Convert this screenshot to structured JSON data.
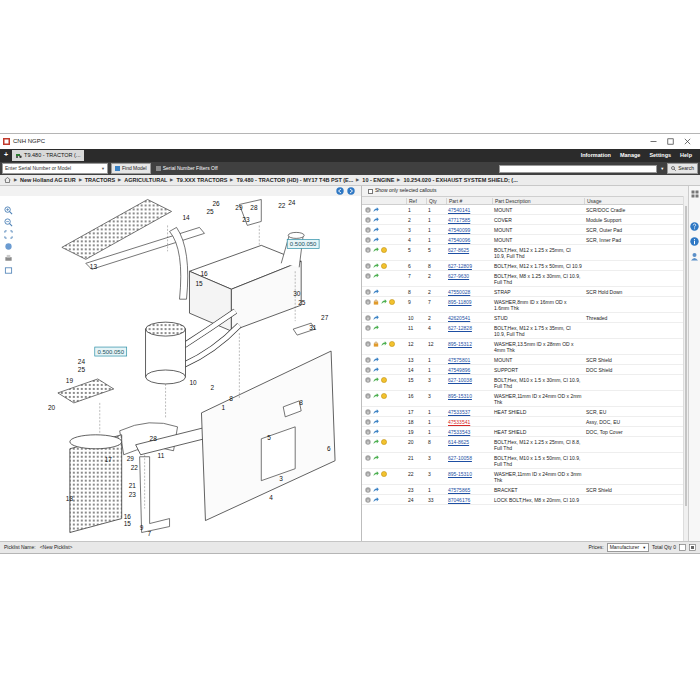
{
  "window": {
    "title": "CNH NGPC"
  },
  "tabs": {
    "new_tab": "+",
    "items": [
      {
        "label": "T9.480 - TRACTOR (...",
        "selected": true
      }
    ]
  },
  "menu": [
    "Information",
    "Manage",
    "Settings",
    "Help"
  ],
  "search_bar": {
    "serial_placeholder": "Enter Serial Number or Model",
    "find_button": "Find Model",
    "filter_label": "Serial Number Filters Off",
    "search_button": "Search"
  },
  "breadcrumb": {
    "separator": "▶",
    "items": [
      "New Holland AG EUR",
      "TRACTORS",
      "AGRICULTURAL",
      "T9.XXX TRACTORS",
      "T9.480 - TRACTOR (HD) - MY17 T4B PST (E...",
      "10 - ENGINE",
      "10.254.020 - EXHAUST SYSTEM SHIELD; (..."
    ]
  },
  "diagram": {
    "callouts": [
      "26",
      "25",
      "13",
      "14",
      "29",
      "28",
      "23",
      "22",
      "24",
      "16",
      "15",
      "30",
      "25",
      "27",
      "31",
      "24",
      "25",
      "19",
      "20",
      "10",
      "2",
      "8",
      "1",
      "28",
      "11",
      "29",
      "17",
      "22",
      "21",
      "23",
      "8",
      "5",
      "3",
      "4",
      "18",
      "16",
      "15",
      "9",
      "7",
      "6"
    ],
    "boxes": [
      "0.500.050",
      "0.500.050"
    ]
  },
  "table": {
    "filter": {
      "label": "Show only selected callouts",
      "checked": false
    },
    "columns": [
      "Ref",
      "Qty",
      "Part #",
      "Part Description",
      "Usage"
    ],
    "rows": [
      {
        "ref": "1",
        "qty": "1",
        "part": "47540141",
        "desc": "MOUNT",
        "usage": "SCR/DOC Cradle",
        "icons": [
          "info",
          "link"
        ],
        "color": "#1e4fa3"
      },
      {
        "ref": "2",
        "qty": "1",
        "part": "47717585",
        "desc": "COVER",
        "usage": "Module Support",
        "icons": [
          "info",
          "link"
        ],
        "color": "#1e4fa3"
      },
      {
        "ref": "3",
        "qty": "1",
        "part": "47540099",
        "desc": "MOUNT",
        "usage": "SCR, Outer Pad",
        "icons": [
          "info",
          "link"
        ],
        "color": "#1e4fa3"
      },
      {
        "ref": "4",
        "qty": "1",
        "part": "47540096",
        "desc": "MOUNT",
        "usage": "SCR, Inner Pad",
        "icons": [
          "info",
          "link"
        ],
        "color": "#1e4fa3"
      },
      {
        "ref": "5",
        "qty": "5",
        "part": "627-8625",
        "desc": "BOLT,Hex, M12 x 1.25 x 25mm, Cl 10.9, Full Thd",
        "usage": "",
        "icons": [
          "info",
          "green",
          "yellow"
        ],
        "color": "#1e4fa3"
      },
      {
        "ref": "6",
        "qty": "8",
        "part": "627-12809",
        "desc": "BOLT,Hex, M12 x 1.75 x 50mm, Cl 10.9",
        "usage": "",
        "icons": [
          "info",
          "green",
          "yellow"
        ],
        "color": "#1e4fa3"
      },
      {
        "ref": "7",
        "qty": "2",
        "part": "627-9630",
        "desc": "BOLT,Hex, M8 x 1.25 x 30mm, Cl 10.9, Full Thd",
        "usage": "",
        "icons": [
          "info",
          "green"
        ],
        "color": "#1e4fa3"
      },
      {
        "ref": "8",
        "qty": "2",
        "part": "47550028",
        "desc": "STRAP",
        "usage": "SCR Hold Down",
        "icons": [
          "info",
          "link"
        ],
        "color": "#1e4fa3"
      },
      {
        "ref": "9",
        "qty": "7",
        "part": "895-11809",
        "desc": "WASHER,8mm ID x 16mm OD x 1.6mm Thk",
        "usage": "",
        "icons": [
          "info",
          "lock",
          "green",
          "yellow"
        ],
        "color": "#1e4fa3"
      },
      {
        "ref": "10",
        "qty": "2",
        "part": "42620541",
        "desc": "STUD",
        "usage": "Threaded",
        "icons": [
          "info",
          "link"
        ],
        "color": "#1e4fa3"
      },
      {
        "ref": "11",
        "qty": "4",
        "part": "627-12828",
        "desc": "BOLT,Hex, M12 x 1.75 x 35mm, Cl 10.9, Full Thd",
        "usage": "",
        "icons": [
          "info",
          "green"
        ],
        "color": "#1e4fa3"
      },
      {
        "ref": "12",
        "qty": "12",
        "part": "895-15312",
        "desc": "WASHER,13.5mm ID x 28mm OD x 4mm Thk",
        "usage": "",
        "icons": [
          "info",
          "lock",
          "green",
          "yellow"
        ],
        "color": "#1e4fa3"
      },
      {
        "ref": "13",
        "qty": "1",
        "part": "47575801",
        "desc": "MOUNT",
        "usage": "SCR Shield",
        "icons": [
          "info",
          "link"
        ],
        "color": "#1e4fa3"
      },
      {
        "ref": "14",
        "qty": "1",
        "part": "47549896",
        "desc": "SUPPORT",
        "usage": "DOC Shield",
        "icons": [
          "info",
          "link"
        ],
        "color": "#1e4fa3"
      },
      {
        "ref": "15",
        "qty": "3",
        "part": "627-10038",
        "desc": "BOLT,Hex, M10 x 1.5 x 30mm, Cl 10.9, Full Thd",
        "usage": "",
        "icons": [
          "info",
          "green",
          "yellow"
        ],
        "color": "#1e4fa3"
      },
      {
        "ref": "16",
        "qty": "3",
        "part": "895-15310",
        "desc": "WASHER,11mm ID x 24mm OD x 2mm Thk",
        "usage": "",
        "icons": [
          "info",
          "green",
          "yellow"
        ],
        "color": "#1e4fa3"
      },
      {
        "ref": "17",
        "qty": "1",
        "part": "47533537",
        "desc": "HEAT SHIELD",
        "usage": "SCR, EU",
        "icons": [
          "info",
          "link"
        ],
        "color": "#1e4fa3"
      },
      {
        "ref": "18",
        "qty": "1",
        "part": "47533541",
        "desc": "",
        "usage": "Assy, DOC, EU",
        "icons": [
          "info",
          "link"
        ],
        "color": "#d62828"
      },
      {
        "ref": "19",
        "qty": "1",
        "part": "47533543",
        "desc": "HEAT SHIELD",
        "usage": "DOC, Top Cover",
        "icons": [
          "info",
          "link"
        ],
        "color": "#1e4fa3"
      },
      {
        "ref": "20",
        "qty": "8",
        "part": "614-8625",
        "desc": "BOLT,Hex, M12 x 1.25 x 25mm, Cl 8.8, Full Thd",
        "usage": "",
        "icons": [
          "info",
          "green",
          "yellow"
        ],
        "color": "#1e4fa3"
      },
      {
        "ref": "21",
        "qty": "3",
        "part": "627-10058",
        "desc": "BOLT,Hex, M10 x 1.5 x 50mm, Cl 10.9, Full Thd",
        "usage": "",
        "icons": [
          "info",
          "green"
        ],
        "color": "#1e4fa3"
      },
      {
        "ref": "22",
        "qty": "3",
        "part": "895-15310",
        "desc": "WASHER,11mm ID x 24mm OD x 3mm Thk",
        "usage": "",
        "icons": [
          "info",
          "green",
          "yellow"
        ],
        "color": "#1e4fa3"
      },
      {
        "ref": "23",
        "qty": "1",
        "part": "47575865",
        "desc": "BRACKET",
        "usage": "SCR Shield",
        "icons": [
          "info",
          "link"
        ],
        "color": "#1e4fa3"
      },
      {
        "ref": "24",
        "qty": "33",
        "part": "87046176",
        "desc": "LOCK BOLT,Hex, M8 x 20mm, Cl 10.9",
        "usage": "",
        "icons": [
          "info",
          "link"
        ],
        "color": "#1e4fa3"
      }
    ]
  },
  "status_bar": {
    "picklist_label": "Picklist Name:",
    "picklist_value": "<New Picklist>",
    "prices_label": "Prices:",
    "prices_value": "Manufacturer",
    "total": "Total Qty 0"
  }
}
